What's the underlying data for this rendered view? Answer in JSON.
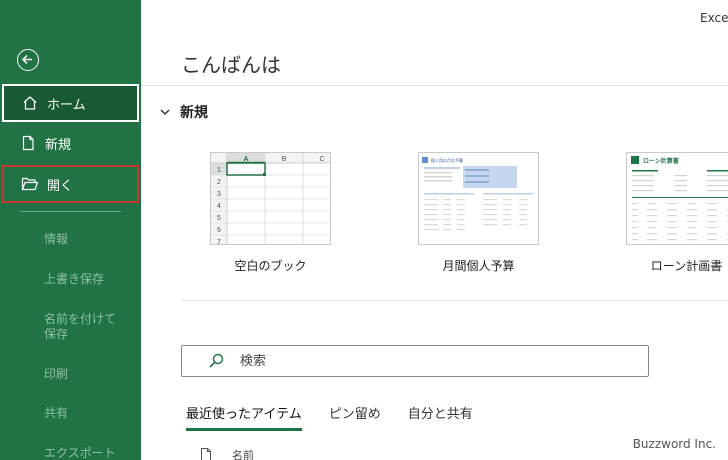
{
  "app": {
    "title": "Exce"
  },
  "sidebar": {
    "back_icon": "back-arrow-icon",
    "items": [
      {
        "label": "ホーム",
        "icon": "home-icon"
      },
      {
        "label": "新規",
        "icon": "new-document-icon"
      },
      {
        "label": "開く",
        "icon": "folder-open-icon"
      }
    ],
    "sub_items": [
      "情報",
      "上書き保存",
      "名前を付けて保存",
      "印刷",
      "共有",
      "エクスポート"
    ]
  },
  "main": {
    "greeting": "こんばんは",
    "new_section": {
      "heading": "新規",
      "templates": [
        {
          "caption": "空白のブック"
        },
        {
          "caption": "月間個人予算",
          "thumb_title": "個人用の月次予算"
        },
        {
          "caption": "ローン計画書",
          "thumb_title": "ローン計算書"
        }
      ]
    },
    "search": {
      "placeholder": "検索"
    },
    "tabs": [
      "最近使ったアイテム",
      "ピン留め",
      "自分と共有"
    ],
    "list_header": {
      "name": "名前"
    }
  },
  "blank_thumb": {
    "cols": [
      "A",
      "B",
      "C"
    ],
    "rows": [
      "1",
      "2",
      "3",
      "4",
      "5",
      "6",
      "7"
    ]
  },
  "colors": {
    "accent": "#217346",
    "accent_dark": "#185a33",
    "highlight_border": "#c0392b"
  },
  "watermark": "Buzzword Inc."
}
